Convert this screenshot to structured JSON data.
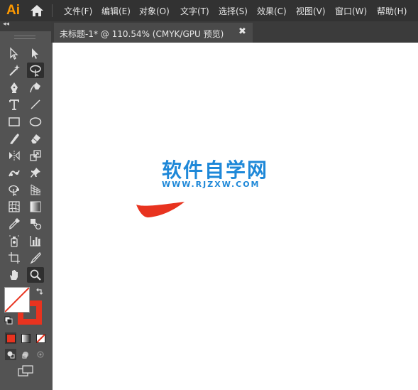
{
  "app": {
    "logo": "Ai"
  },
  "menu": {
    "items": [
      "文件(F)",
      "编辑(E)",
      "对象(O)",
      "文字(T)",
      "选择(S)",
      "效果(C)",
      "视图(V)",
      "窗口(W)",
      "帮助(H)"
    ]
  },
  "toolbar": {
    "collapse_label": "◂◂"
  },
  "document": {
    "tab_label": "未标题-1* @ 110.54% (CMYK/GPU 预览)",
    "close_label": "✖"
  },
  "canvas": {
    "watermark_title": "软件自学网",
    "watermark_url": "WWW.RJZXW.COM"
  },
  "colors": {
    "fill": "#ffffff",
    "stroke": "#e8331f",
    "shape": "#e8331f",
    "accent": "#1e88d8"
  }
}
